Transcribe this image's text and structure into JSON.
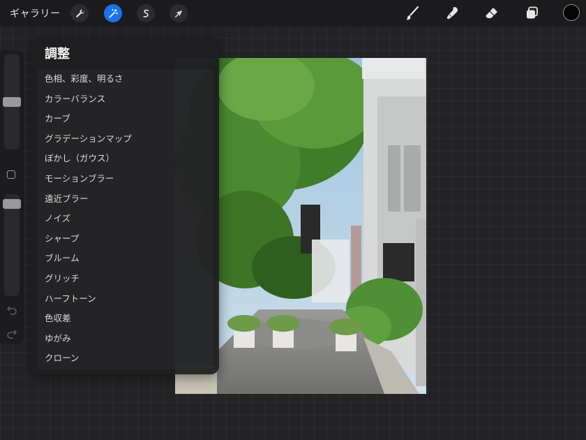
{
  "toolbar": {
    "gallery_label": "ギャラリー",
    "left_tools": [
      {
        "icon": "wrench-icon",
        "name": "actions"
      },
      {
        "icon": "magic-wand-icon",
        "name": "adjustments",
        "active": true
      },
      {
        "icon": "selection-icon",
        "name": "selection"
      },
      {
        "icon": "arrow-cursor-icon",
        "name": "transform"
      }
    ],
    "right_tools": [
      {
        "icon": "brush-icon",
        "name": "paint"
      },
      {
        "icon": "smudge-icon",
        "name": "smudge"
      },
      {
        "icon": "eraser-icon",
        "name": "erase"
      },
      {
        "icon": "layers-icon",
        "name": "layers"
      }
    ],
    "active_color": "#050505",
    "accent_color": "#1a73e8"
  },
  "adjustments": {
    "title": "調整",
    "items": [
      "色相、彩度、明るさ",
      "カラーバランス",
      "カーブ",
      "グラデーションマップ",
      "ぼかし（ガウス）",
      "モーションブラー",
      "遠近ブラー",
      "ノイズ",
      "シャープ",
      "ブルーム",
      "グリッチ",
      "ハーフトーン",
      "色収差",
      "ゆがみ",
      "クローン"
    ]
  },
  "sidebar": {
    "brush_size_level": 0.5,
    "opacity_level": 0.95,
    "icons": [
      "modify-square-icon",
      "undo-icon",
      "redo-icon"
    ]
  },
  "canvas": {
    "content": "photo-street-scene"
  }
}
